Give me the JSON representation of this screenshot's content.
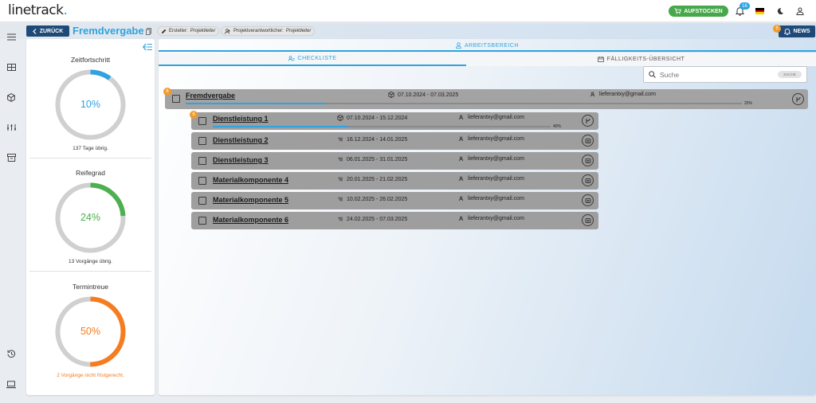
{
  "app": {
    "logo_text": "linetrack",
    "logo_dot": "."
  },
  "topbar": {
    "aufstocken_label": "AUFSTOCKEN",
    "notification_count": "16",
    "icons": [
      "cart-plus-icon",
      "bell-icon",
      "german-flag-icon",
      "moon-icon",
      "user-icon"
    ]
  },
  "header": {
    "back_label": "ZURÜCK",
    "title": "Fremdvergabe",
    "creator_label": "Ersteller:",
    "creator_value": "Projektleiter",
    "owner_label": "Projektverantwortlicher:",
    "owner_value": "Projektleiter",
    "news_label": "NEWS",
    "news_badge": "5"
  },
  "colors": {
    "accent": "#2ea3e0",
    "navy": "#1f4a78",
    "green": "#46a84a",
    "orange": "#f57c1f",
    "badge": "#f19a2b"
  },
  "panel": {
    "kpis": [
      {
        "title": "Zeitfortschritt",
        "value": "10%",
        "fraction": 0.1,
        "color": "#2ea3e0",
        "sub": "137 Tage übrig."
      },
      {
        "title": "Reifegrad",
        "value": "24%",
        "fraction": 0.24,
        "color": "#4caf50",
        "sub": "13 Vorgänge übrig."
      },
      {
        "title": "Termintreue",
        "value": "50%",
        "fraction": 0.5,
        "color": "#f57c1f",
        "sub": "2 Vorgänge nicht fristgerecht."
      }
    ]
  },
  "main": {
    "workspace_label": "ARBEITSBEREICH",
    "tab_checkliste": "CHECKLISTE",
    "tab_faelligkeit": "FÄLLIGKEITS-ÜBERSICHT",
    "search_placeholder": "Suche",
    "search_button": "SUCHE",
    "parent": {
      "badge": "6",
      "title": "Fremdvergabe",
      "dates": "07.10.2024 - 07.03.2025",
      "email": "lieferantxy@gmail.com",
      "progress_label": "25%",
      "progress": 0.25
    },
    "children": [
      {
        "badge": "6",
        "title": "Dienstleistung 1",
        "dates": "07.10.2024 - 15.12.2024",
        "email": "lieferantxy@gmail.com",
        "progress_label": "40%",
        "progress": 0.4,
        "icon": "branch-icon"
      },
      {
        "title": "Dienstleistung 2",
        "dates": "16.12.2024 - 14.01.2025",
        "email": "lieferantxy@gmail.com",
        "icon": "list-icon"
      },
      {
        "title": "Dienstleistung 3",
        "dates": "06.01.2025 - 31.01.2025",
        "email": "lieferantxy@gmail.com",
        "icon": "list-icon"
      },
      {
        "title": "Materialkomponente 4",
        "dates": "20.01.2025 - 21.02.2025",
        "email": "lieferantxy@gmail.com",
        "icon": "list-icon"
      },
      {
        "title": "Materialkomponente 5",
        "dates": "10.02.2025 - 26.02.2025",
        "email": "lieferantxy@gmail.com",
        "icon": "list-icon"
      },
      {
        "title": "Materialkomponente 6",
        "dates": "24.02.2025 - 07.03.2025",
        "email": "lieferantxy@gmail.com",
        "icon": "list-icon"
      }
    ]
  }
}
